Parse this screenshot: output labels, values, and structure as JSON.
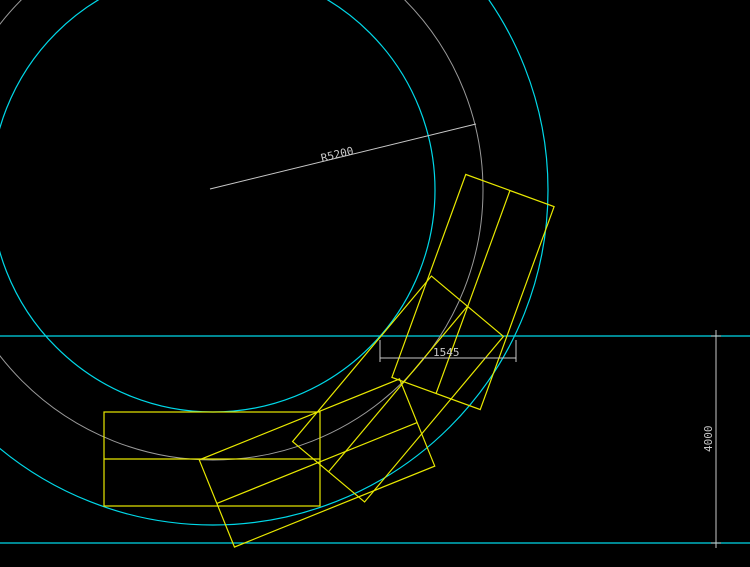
{
  "drawing": {
    "background": "#000000",
    "colors": {
      "boundary": "#00d8e8",
      "centerline": "#9a9a9a",
      "vehicle": "#e8e800",
      "dimension": "#c8c8c8"
    },
    "dimensions": {
      "radius_label": "R5200",
      "clearance_label": "1545",
      "road_width_label": "4000"
    }
  }
}
